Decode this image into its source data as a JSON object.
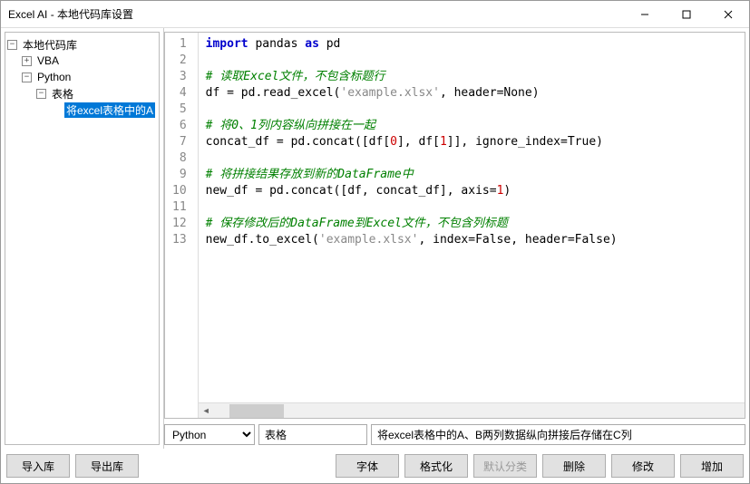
{
  "window": {
    "title": "Excel AI - 本地代码库设置"
  },
  "tree": {
    "root": "本地代码库",
    "items": [
      {
        "label": "VBA",
        "indent": 1,
        "exp": "+"
      },
      {
        "label": "Python",
        "indent": 1,
        "exp": "−"
      },
      {
        "label": "表格",
        "indent": 2,
        "exp": "−"
      },
      {
        "label": "将excel表格中的A",
        "indent": 3,
        "selected": true
      }
    ]
  },
  "code": {
    "lines": [
      {
        "n": 1,
        "seg": [
          {
            "t": "import",
            "c": "kw"
          },
          {
            "t": " pandas "
          },
          {
            "t": "as",
            "c": "kw"
          },
          {
            "t": " pd"
          }
        ]
      },
      {
        "n": 2,
        "seg": []
      },
      {
        "n": 3,
        "seg": [
          {
            "t": "# 读取Excel文件，不包含标题行",
            "c": "cm"
          }
        ]
      },
      {
        "n": 4,
        "seg": [
          {
            "t": "df = pd.read_excel("
          },
          {
            "t": "'example.xlsx'",
            "c": "str"
          },
          {
            "t": ", header=None)"
          }
        ]
      },
      {
        "n": 5,
        "seg": []
      },
      {
        "n": 6,
        "seg": [
          {
            "t": "# 将0、1列内容纵向拼接在一起",
            "c": "cm"
          }
        ]
      },
      {
        "n": 7,
        "seg": [
          {
            "t": "concat_df = pd.concat([df["
          },
          {
            "t": "0",
            "c": "num"
          },
          {
            "t": "], df["
          },
          {
            "t": "1",
            "c": "num"
          },
          {
            "t": "]], ignore_index=True)"
          }
        ]
      },
      {
        "n": 8,
        "seg": []
      },
      {
        "n": 9,
        "seg": [
          {
            "t": "# 将拼接结果存放到新的DataFrame中",
            "c": "cm"
          }
        ]
      },
      {
        "n": 10,
        "seg": [
          {
            "t": "new_df = pd.concat([df, concat_df], axis="
          },
          {
            "t": "1",
            "c": "num"
          },
          {
            "t": ")"
          }
        ]
      },
      {
        "n": 11,
        "seg": []
      },
      {
        "n": 12,
        "seg": [
          {
            "t": "# 保存修改后的DataFrame到Excel文件，不包含列标题",
            "c": "cm"
          }
        ]
      },
      {
        "n": 13,
        "seg": [
          {
            "t": "new_df.to_excel("
          },
          {
            "t": "'example.xlsx'",
            "c": "str"
          },
          {
            "t": ", index=False, header=False)"
          }
        ]
      }
    ]
  },
  "mid": {
    "language": "Python",
    "category": "表格",
    "description": "将excel表格中的A、B两列数据纵向拼接后存储在C列"
  },
  "buttons": {
    "import": "导入库",
    "export": "导出库",
    "font": "字体",
    "format": "格式化",
    "defaultcat": "默认分类",
    "delete": "删除",
    "modify": "修改",
    "add": "增加"
  }
}
